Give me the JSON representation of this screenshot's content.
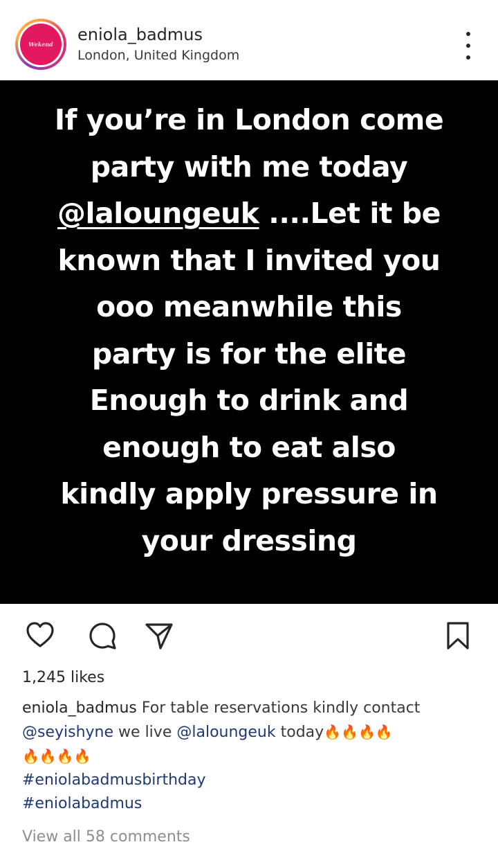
{
  "header": {
    "username": "eniola_badmus",
    "location": "London, United Kingdom",
    "avatar_text": "Wekend",
    "more_icon": "more-vertical-icon"
  },
  "story": {
    "line1": "If you’re in London come",
    "line2": "party with me today",
    "line3_mention": "@laloungeuk",
    "line3_rest": " ....Let it be",
    "line4": "known that I invited you",
    "line5": "ooo meanwhile this",
    "line6": "party is for the elite",
    "line7": "Enough to drink and",
    "line8": "enough to eat also",
    "line9": "kindly apply pressure in",
    "line10": "your dressing"
  },
  "actions": {
    "like_icon": "heart-icon",
    "comment_icon": "comment-icon",
    "share_icon": "send-icon",
    "save_icon": "bookmark-icon"
  },
  "likes": "1,245 likes",
  "caption": {
    "username": "eniola_badmus",
    "text1": "For table reservations kindly contact",
    "mention1": "@seyishyne",
    "text2": "we live",
    "mention2": "@laloungeuk",
    "text3": "today",
    "fires_line1": "🔥🔥🔥🔥",
    "fires_line2": "🔥🔥🔥🔥",
    "hashtag1": "#eniolabadmusbirthday",
    "hashtag2": "#eniolabadmus"
  },
  "view_comments": "View all 58 comments",
  "colors": {
    "link": "#1f3a73",
    "avatar": "#e3195f",
    "story_bg": "#000000"
  }
}
